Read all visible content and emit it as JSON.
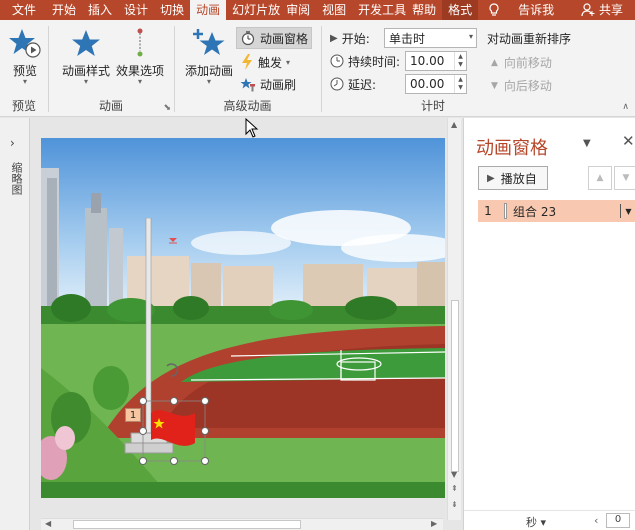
{
  "tabs": [
    "文件",
    "开始",
    "插入",
    "设计",
    "切换",
    "动画",
    "幻灯片放",
    "审阅",
    "视图",
    "开发工具",
    "帮助",
    "格式"
  ],
  "active_tab": "动画",
  "tell_me": "告诉我",
  "share": "共享",
  "ribbon": {
    "preview": {
      "button": "预览",
      "group": "预览"
    },
    "animation": {
      "style_button": "动画样式",
      "effect_button": "效果选项",
      "group": "动画"
    },
    "advanced": {
      "add_button": "添加动画",
      "pane_button": "动画窗格",
      "trigger_button": "触发",
      "painter_button": "动画刷",
      "group": "高级动画"
    },
    "timing": {
      "start_label": "开始:",
      "start_value": "单击时",
      "duration_label": "持续时间:",
      "duration_value": "10.00",
      "delay_label": "延迟:",
      "delay_value": "00.00",
      "group": "计时"
    },
    "reorder": {
      "title": "对动画重新排序",
      "earlier": "向前移动",
      "later": "向后移动"
    }
  },
  "thumbnails_label": "缩略图",
  "slide": {
    "tag_number": "1"
  },
  "pane": {
    "title": "动画窗格",
    "play_button": "播放自",
    "items": [
      {
        "number": "1",
        "name": "组合 23"
      }
    ],
    "footer_unit": "秒",
    "footer_value": "0"
  },
  "colors": {
    "accent": "#b7472a",
    "selected_item": "#f8c9b0"
  }
}
